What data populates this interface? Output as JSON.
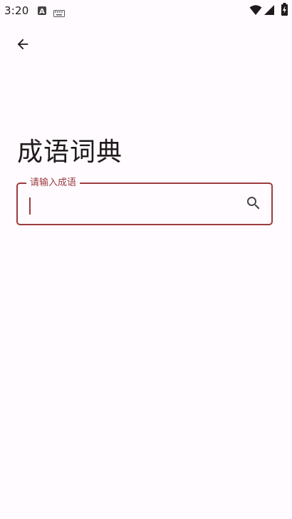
{
  "status_bar": {
    "time": "3:20",
    "icons": [
      "notification-a-icon",
      "keyboard-icon",
      "wifi-icon",
      "signal-icon",
      "battery-icon"
    ]
  },
  "header": {
    "back_icon": "arrow-back-icon"
  },
  "page": {
    "title": "成语词典"
  },
  "search": {
    "label": "请输入成语",
    "value": "",
    "icon": "search-icon"
  },
  "colors": {
    "background": "#fffbfe",
    "accent": "#9c3b40",
    "text": "#1f1b1c"
  }
}
